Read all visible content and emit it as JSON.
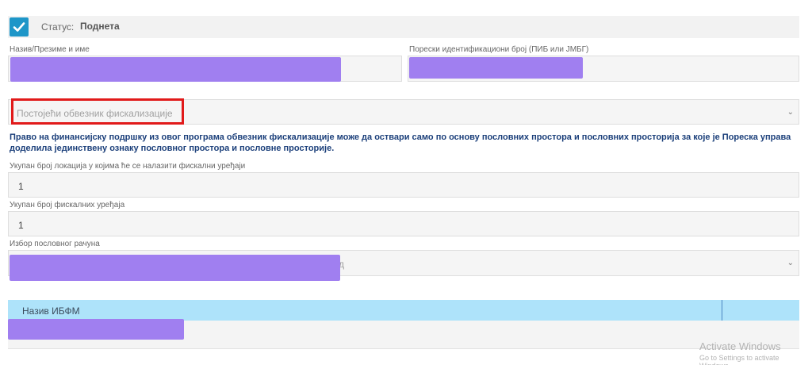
{
  "status": {
    "label": "Статус:",
    "value": "Поднета"
  },
  "form": {
    "name_label": "Назив/Презиме и име",
    "tax_id_label": "Порески идентификациони број (ПИБ или ЈМБГ)",
    "taxpayer_select": {
      "value": "Постојећи обвезник фискализације"
    },
    "notice": "Право на финансијску подршку из овог програма обвезник фискализације може да оствари само по основу пословних простора и пословних просторија за које је Пореска управа доделила јединствену ознаку пословног простора и пословне просторије.",
    "locations": {
      "label": "Укупан број локација у којима ће се налазити фискални уређаји",
      "value": "1"
    },
    "devices": {
      "label": "Укупан број фискалних уређаја",
      "value": "1"
    },
    "account": {
      "label": "Избор пословног рачуна",
      "trailing_fragment": "д"
    }
  },
  "table": {
    "column_header": "Назив ИБФМ"
  },
  "watermark": {
    "title": "Activate Windows",
    "subtitle": "Go to Settings to activate Windows."
  },
  "colors": {
    "accent": "#1e96c8",
    "redaction": "#a07ff0",
    "notice_text": "#1b3f7a",
    "highlight_border": "#e11a1a",
    "table_header": "#aee3fa"
  },
  "icons": {
    "status": "checkmark-icon",
    "select": "chevron-down-icon"
  }
}
